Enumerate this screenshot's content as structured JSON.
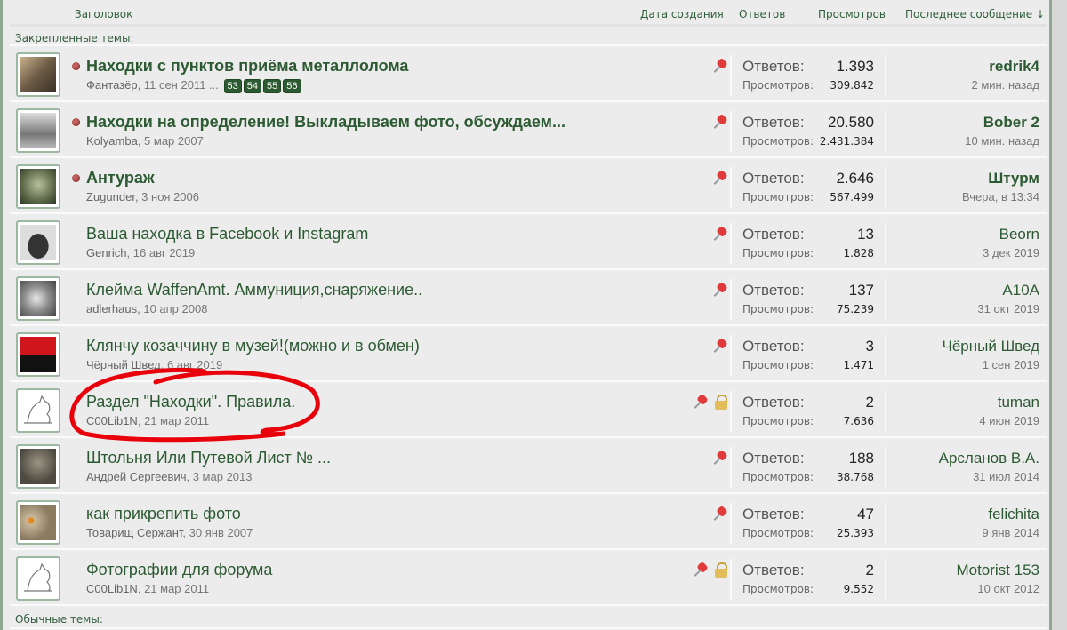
{
  "header": {
    "title": "Заголовок",
    "date": "Дата создания",
    "replies": "Ответов",
    "views": "Просмотров",
    "last": "Последнее сообщение ↓"
  },
  "sections": {
    "sticky": "Закрепленные темы:",
    "normal": "Обычные темы:"
  },
  "labels": {
    "replies": "Ответов:",
    "views": "Просмотров:"
  },
  "threads": [
    {
      "title": "Находки с пунктов приёма металлолома",
      "author": "Фантазёр",
      "date": "11 сен 2011",
      "pages": [
        "53",
        "54",
        "55",
        "56"
      ],
      "ellipsis": "...",
      "replies": "1.393",
      "views": "309.842",
      "last_user": "redrik4",
      "last_time": "2 мин. назад",
      "unread": true,
      "locked": false,
      "avatar": "soldier"
    },
    {
      "title": "Находки на определение! Выкладываем фото, обсуждаем...",
      "author": "Kolyamba",
      "date": "5 мар 2007",
      "replies": "20.580",
      "views": "2.431.384",
      "last_user": "Bober 2",
      "last_time": "10 мин. назад",
      "unread": true,
      "locked": false,
      "avatar": "photo"
    },
    {
      "title": "Антураж",
      "author": "Zugunder",
      "date": "3 ноя 2006",
      "replies": "2.646",
      "views": "567.499",
      "last_user": "Штурм",
      "last_time": "Вчера, в 13:34",
      "unread": true,
      "locked": false,
      "avatar": "mask"
    },
    {
      "title": "Ваша находка в Facebook и Instagram",
      "author": "Genrich",
      "date": "16 авг 2019",
      "replies": "13",
      "views": "1.828",
      "last_user": "Beorn",
      "last_time": "3 дек 2019",
      "unread": false,
      "locked": false,
      "avatar": "helmet"
    },
    {
      "title": "Клейма WaffenAmt. Аммуниция,снаряжение..",
      "author": "adlerhaus",
      "date": "10 апр 2008",
      "replies": "137",
      "views": "75.239",
      "last_user": "A10A",
      "last_time": "31 окт 2019",
      "unread": false,
      "locked": false,
      "avatar": "eagle"
    },
    {
      "title": "Клянчу козаччину в музей!(можно и в обмен)",
      "author": "Чёрный Швед",
      "date": "6 авг 2019",
      "replies": "3",
      "views": "1.471",
      "last_user": "Чёрный Швед",
      "last_time": "1 сен 2019",
      "unread": false,
      "locked": false,
      "avatar": "flag"
    },
    {
      "title": "Раздел \"Находки\". Правила.",
      "author": "C00Lib1N",
      "date": "21 мар 2011",
      "replies": "2",
      "views": "7.636",
      "last_user": "tuman",
      "last_time": "4 июн 2019",
      "unread": false,
      "locked": true,
      "avatar": "cat"
    },
    {
      "title": "Штольня Или Путевой Лист № ...",
      "author": "Андрей Сергеевич",
      "date": "3 мар 2013",
      "replies": "188",
      "views": "38.768",
      "last_user": "Арсланов В.А.",
      "last_time": "31 июл 2014",
      "unread": false,
      "locked": false,
      "avatar": "soldier2"
    },
    {
      "title": "как прикрепить фото",
      "author": "Товарищ Сержант",
      "date": "30 янв 2007",
      "replies": "47",
      "views": "25.393",
      "last_user": "felichita",
      "last_time": "9 янв 2014",
      "unread": false,
      "locked": false,
      "avatar": "owl"
    },
    {
      "title": "Фотографии для форума",
      "author": "C00Lib1N",
      "date": "21 мар 2011",
      "replies": "2",
      "views": "9.552",
      "last_user": "Motorist 153",
      "last_time": "10 окт 2012",
      "unread": false,
      "locked": true,
      "avatar": "cat"
    }
  ],
  "colors": {
    "link": "#2c5a32",
    "annotation": "#e8000b"
  }
}
